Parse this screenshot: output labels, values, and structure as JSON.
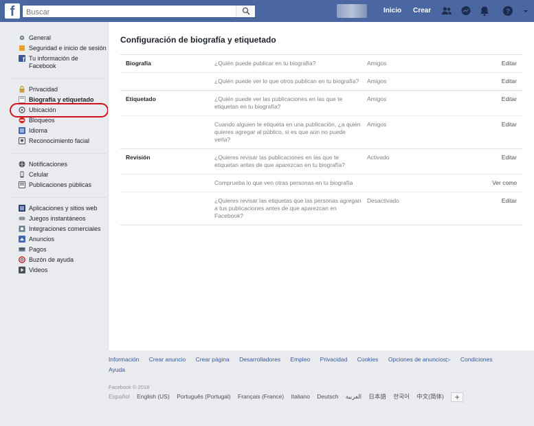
{
  "colors": {
    "topbar": "#4b67a1",
    "highlight": "#d0101a",
    "link": "#365899"
  },
  "topbar": {
    "logo": "f",
    "search_placeholder": "Buscar",
    "search_icon": "search-icon",
    "home_label": "Inicio",
    "create_label": "Crear",
    "icons": [
      "friends-icon",
      "messenger-icon",
      "notifications-icon",
      "help-icon",
      "chevron-down-icon"
    ]
  },
  "sidebar": {
    "groups": [
      [
        {
          "label": "General",
          "icon": "gear-icon"
        },
        {
          "label": "Seguridad e inicio de sesión",
          "icon": "shield-icon"
        },
        {
          "label": "Tu información de Facebook",
          "icon": "facebook-icon"
        }
      ],
      [
        {
          "label": "Privacidad",
          "icon": "lock-icon"
        },
        {
          "label": "Biografía y etiquetado",
          "icon": "timeline-icon",
          "active": true
        },
        {
          "label": "Ubicación",
          "icon": "location-icon"
        },
        {
          "label": "Bloqueos",
          "icon": "block-icon"
        },
        {
          "label": "Idioma",
          "icon": "language-icon"
        },
        {
          "label": "Reconocimiento facial",
          "icon": "face-icon"
        }
      ],
      [
        {
          "label": "Notificaciones",
          "icon": "globe-icon"
        },
        {
          "label": "Celular",
          "icon": "mobile-icon"
        },
        {
          "label": "Publicaciones públicas",
          "icon": "rss-icon"
        }
      ],
      [
        {
          "label": "Aplicaciones y sitios web",
          "icon": "apps-icon"
        },
        {
          "label": "Juegos instantáneos",
          "icon": "game-icon"
        },
        {
          "label": "Integraciones comerciales",
          "icon": "integration-icon"
        },
        {
          "label": "Anuncios",
          "icon": "ads-icon"
        },
        {
          "label": "Pagos",
          "icon": "payment-icon"
        },
        {
          "label": "Buzón de ayuda",
          "icon": "lifebuoy-icon"
        },
        {
          "label": "Videos",
          "icon": "video-icon"
        }
      ]
    ]
  },
  "main": {
    "title": "Configuración de biografía y etiquetado",
    "sections": [
      {
        "label": "Biografía",
        "rows": [
          {
            "question": "¿Quién puede publicar en tu biografía?",
            "value": "Amigos",
            "action": "Editar"
          },
          {
            "question": "¿Quién puede ver lo que otros publican en tu biografía?",
            "value": "Amigos",
            "action": "Editar"
          }
        ]
      },
      {
        "label": "Etiquetado",
        "rows": [
          {
            "question": "¿Quién puede ver las publicaciones en las que te etiquetan en tu biografía?",
            "value": "Amigos",
            "action": "Editar"
          },
          {
            "question": "Cuando alguien te etiqueta en una publicación, ¿a quién quieres agregar al público, si es que aún no puede verla?",
            "value": "Amigos",
            "action": "Editar"
          }
        ]
      },
      {
        "label": "Revisión",
        "rows": [
          {
            "question": "¿Quieres revisar las publicaciones en las que te etiquetan antes de que aparezcan en tu biografía?",
            "value": "Activado",
            "action": "Editar"
          },
          {
            "question": "Comprueba lo que ven otras personas en tu biografía",
            "value": "",
            "action": "Ver como"
          },
          {
            "question": "¿Quieres revisar las etiquetas que las personas agregan a tus publicaciones antes de que aparezcan en Facebook?",
            "value": "Desactivado",
            "action": "Editar"
          }
        ]
      }
    ]
  },
  "footer": {
    "links": [
      "Información",
      "Crear anuncio",
      "Crear página",
      "Desarrolladores",
      "Empleo",
      "Privacidad",
      "Cookies",
      "Opciones de anuncios▷",
      "Condiciones",
      "Ayuda"
    ],
    "copyright": "Facebook © 2018",
    "current_language": "Español",
    "languages": [
      "English (US)",
      "Português (Portugal)",
      "Français (France)",
      "Italiano",
      "Deutsch",
      "العربية",
      "日本語",
      "한국어",
      "中文(简体)"
    ],
    "more_language": "+"
  }
}
